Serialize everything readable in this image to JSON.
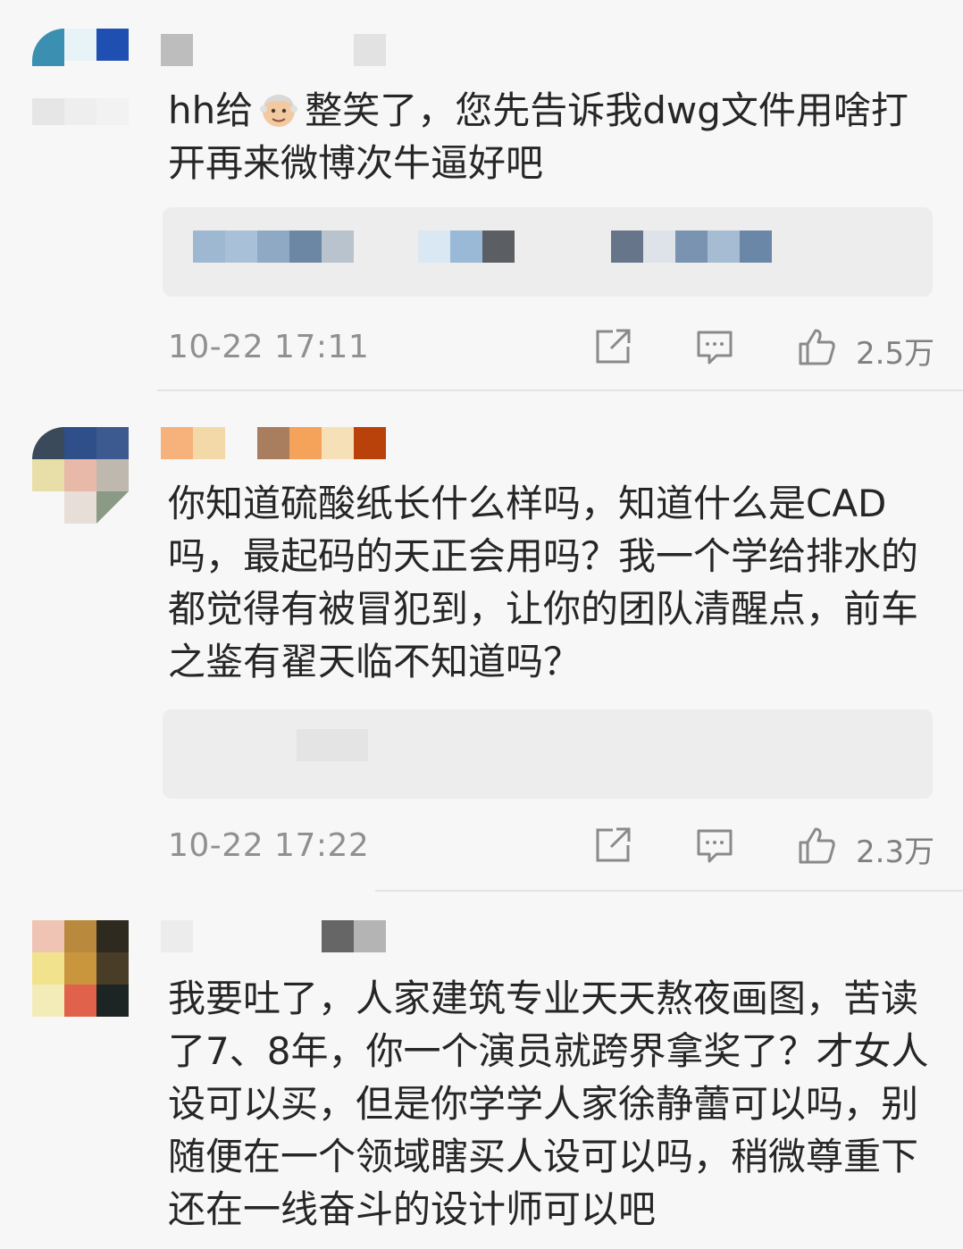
{
  "comments": [
    {
      "text_before_emoji": "hh给",
      "emoji": "old-man-face-emoji",
      "text_after_emoji": "整笑了，您先告诉我dwg文件用啥打开再来微博次牛逼好吧",
      "time": "10-22 17:11",
      "likes": "2.5万",
      "icons": [
        "share-icon",
        "comment-icon",
        "like-icon"
      ]
    },
    {
      "text": "你知道硫酸纸长什么样吗，知道什么是CAD吗，最起码的天正会用吗？我一个学给排水的都觉得有被冒犯到，让你的团队清醒点，前车之鉴有翟天临不知道吗？",
      "time": "10-22 17:22",
      "likes": "2.3万",
      "icons": [
        "share-icon",
        "comment-icon",
        "like-icon"
      ]
    },
    {
      "text": "我要吐了，人家建筑专业天天熬夜画图，苦读了7、8年，你一个演员就跨界拿奖了？才女人设可以买，但是你学学人家徐静蕾可以吗，别随便在一个领域瞎买人设可以吗，稍微尊重下还在一线奋斗的设计师可以吧"
    }
  ],
  "colors": {
    "background": "#f7f7f7",
    "text": "#262626",
    "meta": "#909090",
    "quote_bg": "#ededed"
  }
}
